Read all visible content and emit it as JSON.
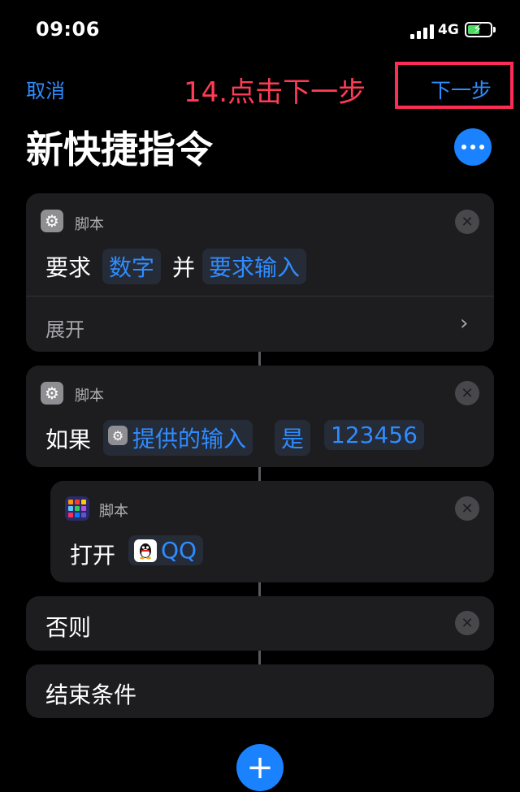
{
  "status_bar": {
    "time": "09:06",
    "network": "4G"
  },
  "nav": {
    "cancel_label": "取消",
    "annotation": "14.点击下一步",
    "next_label": "下一步"
  },
  "title": "新快捷指令",
  "colors": {
    "accent": "#1a82ff",
    "annotation": "#ff2d55",
    "card": "#1d1d20"
  },
  "actions": [
    {
      "category": "脚本",
      "icon": "gear-icon",
      "text": "要求",
      "token1": "数字",
      "conj": "并",
      "token2": "要求输入",
      "expand_label": "展开"
    },
    {
      "category": "脚本",
      "icon": "gear-icon",
      "text": "如果",
      "token1": "提供的输入",
      "token2": "是",
      "token3": "123456"
    },
    {
      "category": "脚本",
      "icon": "apps-icon",
      "text": "打开",
      "token1": "QQ"
    },
    {
      "text": "否则"
    },
    {
      "text": "结束条件"
    }
  ]
}
